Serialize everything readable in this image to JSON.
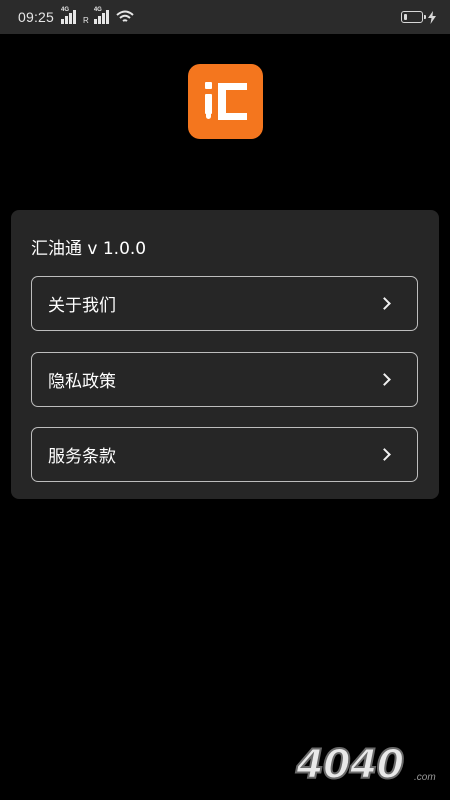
{
  "status_bar": {
    "time": "09:25",
    "network_1": "4G",
    "network_2": "4G",
    "roaming": "R",
    "battery_level": 0.2
  },
  "app": {
    "icon": "huiyoutong-logo-icon",
    "brand_color": "#f4761e",
    "version_label": "汇油通 v 1.0.0"
  },
  "menu": {
    "items": [
      {
        "label": "关于我们",
        "icon": "chevron-right-icon"
      },
      {
        "label": "隐私政策",
        "icon": "chevron-right-icon"
      },
      {
        "label": "服务条款",
        "icon": "chevron-right-icon"
      }
    ]
  },
  "watermark": {
    "text": "4040",
    "suffix": ".com"
  }
}
